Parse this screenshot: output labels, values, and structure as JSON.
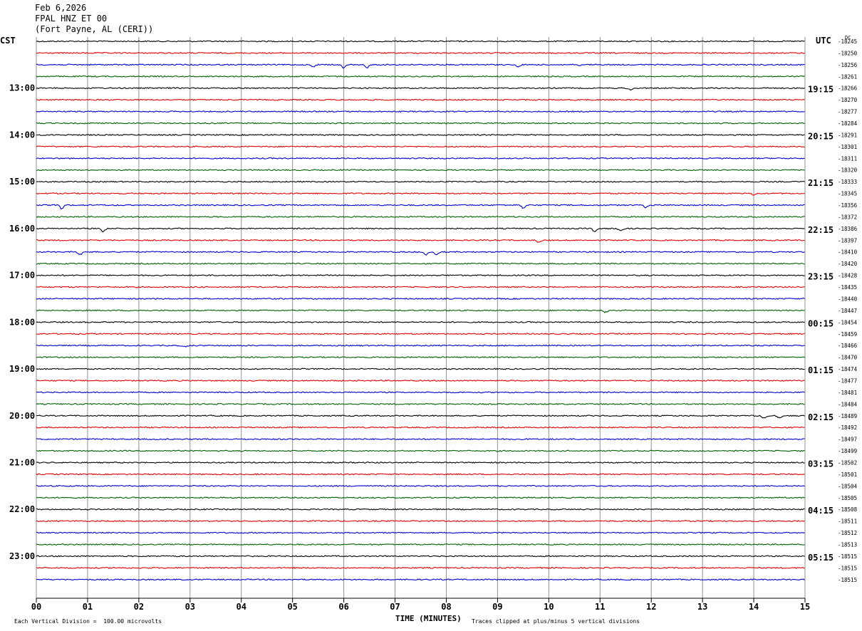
{
  "header": {
    "date": "Feb 6,2026",
    "station": "FPAL HNZ ET 00",
    "location": "(Fort Payne, AL (CERI))"
  },
  "axes": {
    "left_tz": "CST",
    "right_tz": "UTC",
    "dc_label": "DC",
    "x_title": "TIME (MINUTES)",
    "scale_note": "Each Vertical Division =  100.00 microvolts",
    "clip_note": "Traces clipped at plus/minus 5 vertical divisions"
  },
  "colors": {
    "trace_cycle": [
      "#000000",
      "#e00000",
      "#0000d0",
      "#006000"
    ],
    "grid": "#909090"
  },
  "chart_data": {
    "type": "line",
    "title": "FPAL HNZ ET 00",
    "xlabel": "TIME (MINUTES)",
    "xlim": [
      0,
      15
    ],
    "x_ticks": [
      "00",
      "01",
      "02",
      "03",
      "04",
      "05",
      "06",
      "07",
      "08",
      "09",
      "10",
      "11",
      "12",
      "13",
      "14",
      "15"
    ],
    "row_minutes": 15,
    "left_time_labels": [
      {
        "row": 4,
        "label": "13:00"
      },
      {
        "row": 8,
        "label": "14:00"
      },
      {
        "row": 12,
        "label": "15:00"
      },
      {
        "row": 16,
        "label": "16:00"
      },
      {
        "row": 20,
        "label": "17:00"
      },
      {
        "row": 24,
        "label": "18:00"
      },
      {
        "row": 28,
        "label": "19:00"
      },
      {
        "row": 32,
        "label": "20:00"
      },
      {
        "row": 36,
        "label": "21:00"
      },
      {
        "row": 40,
        "label": "22:00"
      },
      {
        "row": 44,
        "label": "23:00"
      }
    ],
    "right_time_labels": [
      {
        "row": 4,
        "label": "19:15"
      },
      {
        "row": 8,
        "label": "20:15"
      },
      {
        "row": 12,
        "label": "21:15"
      },
      {
        "row": 16,
        "label": "22:15"
      },
      {
        "row": 20,
        "label": "23:15"
      },
      {
        "row": 24,
        "label": "00:15"
      },
      {
        "row": 28,
        "label": "01:15"
      },
      {
        "row": 32,
        "label": "02:15"
      },
      {
        "row": 36,
        "label": "03:15"
      },
      {
        "row": 40,
        "label": "04:15"
      },
      {
        "row": 44,
        "label": "05:15"
      }
    ],
    "dc_offsets": [
      "-18245",
      "-18250",
      "-18256",
      "-18261",
      "-18266",
      "-18270",
      "-18277",
      "-18284",
      "-18291",
      "-18301",
      "-18311",
      "-18320",
      "-18333",
      "-18345",
      "-18356",
      "-18372",
      "-18386",
      "-18397",
      "-18410",
      "-18420",
      "-18428",
      "-18435",
      "-18440",
      "-18447",
      "-18454",
      "-18459",
      "-18466",
      "-18470",
      "-18474",
      "-18477",
      "-18481",
      "-18484",
      "-18489",
      "-18492",
      "-18497",
      "-18499",
      "-18502",
      "-18501",
      "-18504",
      "-18505",
      "-18508",
      "-18511",
      "-18512",
      "-18513",
      "-18515",
      "-18515",
      "-18515"
    ],
    "trace_rows": 47,
    "events": [
      {
        "row": 2,
        "minute": 5.4,
        "amp": 3
      },
      {
        "row": 2,
        "minute": 6.0,
        "amp": 4
      },
      {
        "row": 2,
        "minute": 6.45,
        "amp": 5
      },
      {
        "row": 2,
        "minute": 9.4,
        "amp": 3
      },
      {
        "row": 2,
        "minute": 10.6,
        "amp": 2
      },
      {
        "row": 4,
        "minute": 11.6,
        "amp": 3
      },
      {
        "row": 13,
        "minute": 14.0,
        "amp": 2
      },
      {
        "row": 14,
        "minute": 0.5,
        "amp": 5
      },
      {
        "row": 14,
        "minute": 9.5,
        "amp": 4
      },
      {
        "row": 14,
        "minute": 11.9,
        "amp": 3
      },
      {
        "row": 16,
        "minute": 1.3,
        "amp": 4
      },
      {
        "row": 16,
        "minute": 10.9,
        "amp": 4
      },
      {
        "row": 16,
        "minute": 11.4,
        "amp": 3
      },
      {
        "row": 17,
        "minute": 9.8,
        "amp": 3
      },
      {
        "row": 18,
        "minute": 0.85,
        "amp": 4
      },
      {
        "row": 18,
        "minute": 7.6,
        "amp": 4
      },
      {
        "row": 18,
        "minute": 7.8,
        "amp": 4
      },
      {
        "row": 23,
        "minute": 11.1,
        "amp": 3
      },
      {
        "row": 26,
        "minute": 2.9,
        "amp": 2
      },
      {
        "row": 32,
        "minute": 14.2,
        "amp": 3
      },
      {
        "row": 32,
        "minute": 14.5,
        "amp": 3
      }
    ]
  }
}
